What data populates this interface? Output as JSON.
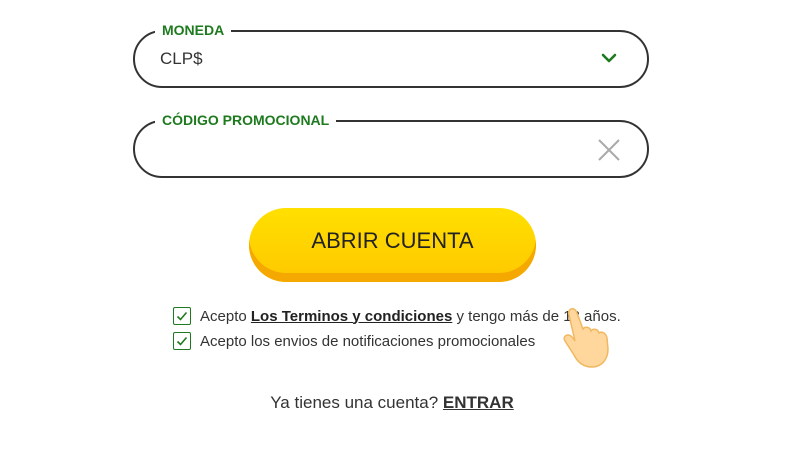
{
  "currency_field": {
    "label": "MONEDA",
    "value": "CLP$",
    "icon": "chevron-down-icon"
  },
  "promo_field": {
    "label": "CÓDIGO PROMOCIONAL",
    "value": "",
    "icon": "close-icon"
  },
  "submit_button": {
    "label": "ABRIR CUENTA"
  },
  "terms": {
    "checked": true,
    "prefix": "Acepto ",
    "link": "Los Terminos y condiciones",
    "suffix": " y tengo más de 18 años."
  },
  "notifications": {
    "checked": true,
    "label": "Acepto los envios de notificaciones promocionales"
  },
  "login": {
    "prompt": "Ya tienes una cuenta?",
    "link": "ENTRAR"
  },
  "colors": {
    "accent_green": "#1e7a1e",
    "button_yellow": "#ffd200",
    "button_shadow": "#f5a800"
  }
}
